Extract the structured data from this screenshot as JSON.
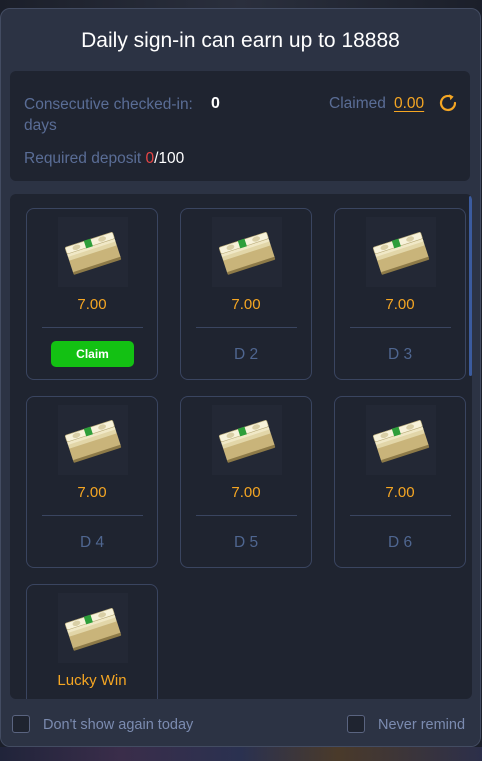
{
  "title": "Daily sign-in can earn up to 18888",
  "info": {
    "consecutive_label": "Consecutive checked-in:",
    "consecutive_value": "0",
    "days_label": "days",
    "claimed_label": "Claimed",
    "claimed_value": "0.00",
    "refresh_icon": "refresh-icon",
    "deposit_label": "Required deposit ",
    "deposit_current": "0",
    "deposit_total": "/100"
  },
  "cards": [
    {
      "amount": "7.00",
      "action": "Claim"
    },
    {
      "amount": "7.00",
      "day": "D 2"
    },
    {
      "amount": "7.00",
      "day": "D 3"
    },
    {
      "amount": "7.00",
      "day": "D 4"
    },
    {
      "amount": "7.00",
      "day": "D 5"
    },
    {
      "amount": "7.00",
      "day": "D 6"
    },
    {
      "label": "Lucky Win"
    }
  ],
  "footer": {
    "dont_show_label": "Don't show again today",
    "never_remind_label": "Never remind"
  },
  "colors": {
    "accent_orange": "#f5a623",
    "claim_green": "#13c113",
    "deposit_red": "#e84545",
    "muted_blue": "#5a6d96"
  }
}
